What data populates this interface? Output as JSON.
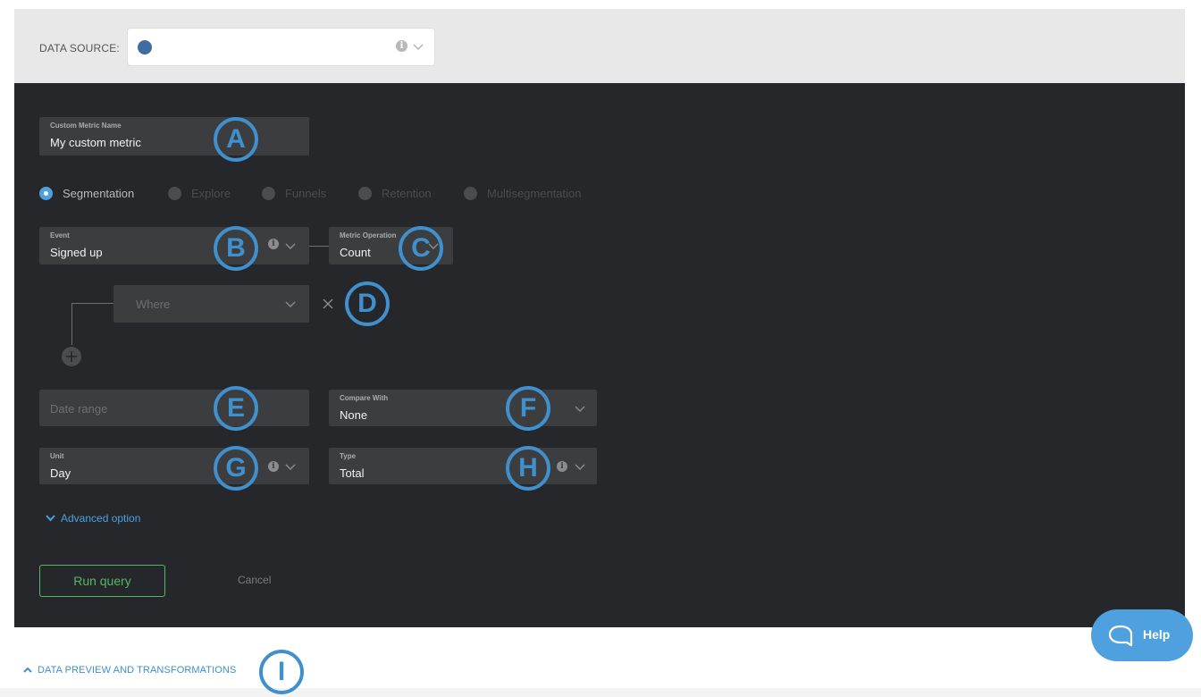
{
  "data_source": {
    "label": "DATA SOURCE:",
    "value": ""
  },
  "metric_name": {
    "label": "Custom Metric Name",
    "value": "My custom metric"
  },
  "tabs": [
    {
      "label": "Segmentation",
      "selected": true
    },
    {
      "label": "Explore",
      "selected": false
    },
    {
      "label": "Funnels",
      "selected": false
    },
    {
      "label": "Retention",
      "selected": false
    },
    {
      "label": "Multisegmentation",
      "selected": false
    }
  ],
  "event": {
    "label": "Event",
    "value": "Signed up"
  },
  "metric_operation": {
    "label": "Metric Operation",
    "value": "Count"
  },
  "where": {
    "placeholder": "Where"
  },
  "date_range": {
    "placeholder": "Date range"
  },
  "compare_with": {
    "label": "Compare With",
    "value": "None"
  },
  "unit": {
    "label": "Unit",
    "value": "Day"
  },
  "type": {
    "label": "Type",
    "value": "Total"
  },
  "advanced_option": "Advanced option",
  "run_query": "Run query",
  "cancel": "Cancel",
  "data_preview": "DATA PREVIEW AND TRANSFORMATIONS",
  "help": "Help",
  "annotations": [
    "A",
    "B",
    "C",
    "D",
    "E",
    "F",
    "G",
    "H",
    "I"
  ],
  "colors": {
    "accent": "#4ea1de",
    "annotation": "#3f90cc",
    "panel": "#25272a",
    "field": "#3c3d3f",
    "run_green": "#54b767"
  }
}
